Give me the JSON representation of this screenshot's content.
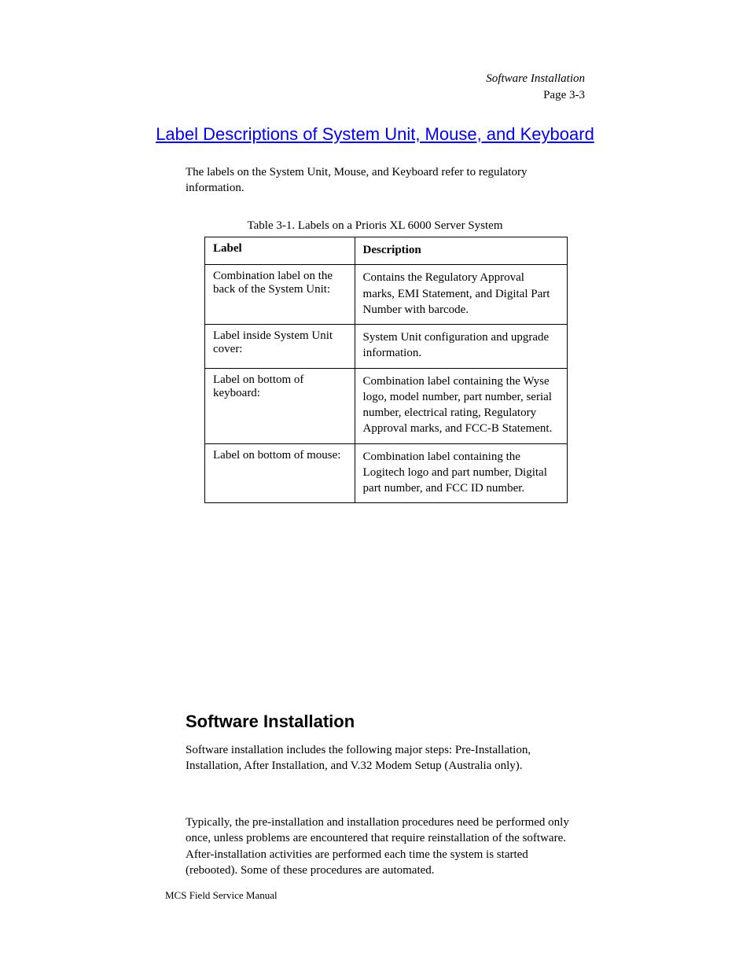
{
  "header": {
    "breadcrumb": "Software Installation",
    "page_label": "Page 3-3"
  },
  "title_link": "Label Descriptions of System Unit, Mouse, and Keyboard",
  "intro": "The labels on the System Unit, Mouse, and Keyboard refer to regulatory information.",
  "table": {
    "caption": "Table 3-1. Labels on a Prioris XL 6000 Server System",
    "headers": {
      "label": "Label",
      "description": "Description"
    },
    "rows": [
      {
        "label": "Combination label on the back of the System Unit:",
        "description": "Contains the Regulatory Approval marks, EMI Statement, and Digital Part Number with barcode."
      },
      {
        "label": "Label inside System Unit cover:",
        "description": "System Unit configuration and upgrade information."
      },
      {
        "label": "Label on bottom of keyboard:",
        "description": "Combination label containing the Wyse logo, model number, part number, serial number, electrical rating, Regulatory Approval marks, and FCC-B Statement."
      },
      {
        "label": "Label on bottom of mouse:",
        "description": "Combination label containing the Logitech logo and part number, Digital part number, and FCC ID number."
      }
    ]
  },
  "section": {
    "heading": "Software Installation",
    "p1": "Software installation includes the following major steps: Pre-Installation, Installation, After Installation, and V.32 Modem Setup (Australia only).",
    "p2": "Typically, the pre-installation and installation procedures need be performed only once, unless problems are encountered that require reinstallation of the software. After-installation activities are performed each time the system is started (rebooted). Some of these procedures are automated."
  },
  "footer": "MCS Field Service Manual"
}
